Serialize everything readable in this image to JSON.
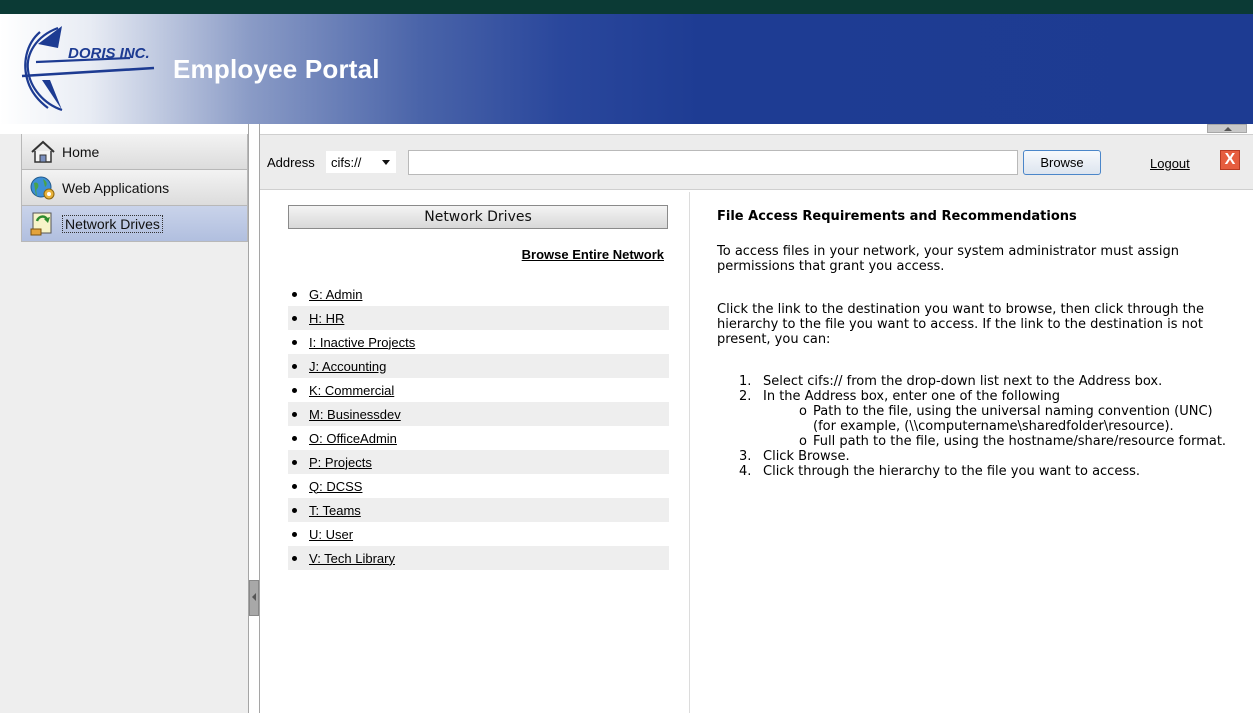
{
  "header": {
    "logo_text": "DORIS INC.",
    "title": "Employee Portal"
  },
  "sidebar": {
    "items": [
      {
        "label": "Home",
        "icon": "home-icon"
      },
      {
        "label": "Web Applications",
        "icon": "globe-gear-icon"
      },
      {
        "label": "Network Drives",
        "icon": "network-drive-icon",
        "active": true
      }
    ]
  },
  "toolbar": {
    "address_label": "Address",
    "protocol_selected": "cifs://",
    "address_value": "",
    "browse_label": "Browse",
    "logout_label": "Logout",
    "logout_icon": "X"
  },
  "drives": {
    "header": "Network Drives",
    "browse_network": "Browse Entire Network",
    "items": [
      "G: Admin",
      "H: HR",
      "I: Inactive Projects",
      "J: Accounting",
      "K: Commercial",
      "M: Businessdev",
      "O: OfficeAdmin",
      "P: Projects",
      "Q: DCSS",
      "T: Teams",
      "U: User",
      "V: Tech Library"
    ]
  },
  "info": {
    "title": "File Access Requirements and Recommendations",
    "p1": "To access files in your network, your system administrator must assign permissions that grant you access.",
    "p2": "Click the link to the destination you want to browse, then click through the hierarchy to the file you want to access. If the link to the destination is not present, you can:",
    "steps": [
      {
        "num": "1.",
        "text": "Select cifs:// from the drop-down list next to the Address box."
      },
      {
        "num": "2.",
        "text": "In the Address box, enter one of the following"
      },
      {
        "num": "3.",
        "text": "Click Browse."
      },
      {
        "num": "4.",
        "text": "Click through the hierarchy to the file you want to access."
      }
    ],
    "substeps": [
      {
        "bullet": "o",
        "text": "Path to the file, using the universal naming convention (UNC) (for example, (\\\\computername\\sharedfolder\\resource)."
      },
      {
        "bullet": "o",
        "text": "Full path to the file, using the hostname/share/resource format."
      }
    ]
  },
  "colors": {
    "header_blue": "#1d3b92",
    "top_strip": "#0b3a35",
    "nav_active": "#b1bfdf",
    "logout_red": "#e65d3f"
  }
}
